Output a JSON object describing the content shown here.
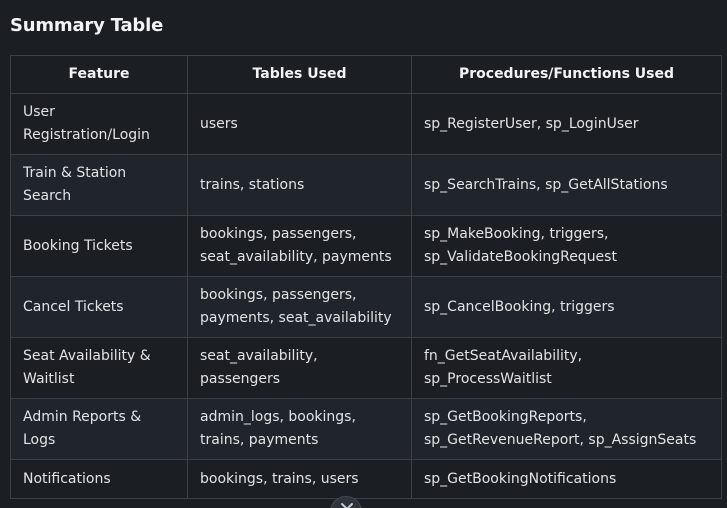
{
  "title": "Summary Table",
  "table": {
    "headers": [
      "Feature",
      "Tables Used",
      "Procedures/Functions Used"
    ],
    "rows": [
      {
        "feature": "User Registration/Login",
        "tables": "users",
        "procedures": "sp_RegisterUser, sp_LoginUser"
      },
      {
        "feature": "Train & Station Search",
        "tables": "trains, stations",
        "procedures": "sp_SearchTrains, sp_GetAllStations"
      },
      {
        "feature": "Booking Tickets",
        "tables": "bookings, passengers, seat_availability, payments",
        "procedures": "sp_MakeBooking, triggers, sp_ValidateBookingRequest"
      },
      {
        "feature": "Cancel Tickets",
        "tables": "bookings, passengers, payments, seat_availability",
        "procedures": "sp_CancelBooking, triggers"
      },
      {
        "feature": "Seat Availability & Waitlist",
        "tables": "seat_availability, passengers",
        "procedures": "fn_GetSeatAvailability, sp_ProcessWaitlist"
      },
      {
        "feature": "Admin Reports & Logs",
        "tables": "admin_logs, bookings, trains, payments",
        "procedures": "sp_GetBookingReports, sp_GetRevenueReport, sp_AssignSeats"
      },
      {
        "feature": "Notifications",
        "tables": "bookings, trains, users",
        "procedures": "sp_GetBookingNotifications"
      }
    ]
  },
  "scroll_button": {
    "icon": "chevron-down-icon"
  }
}
